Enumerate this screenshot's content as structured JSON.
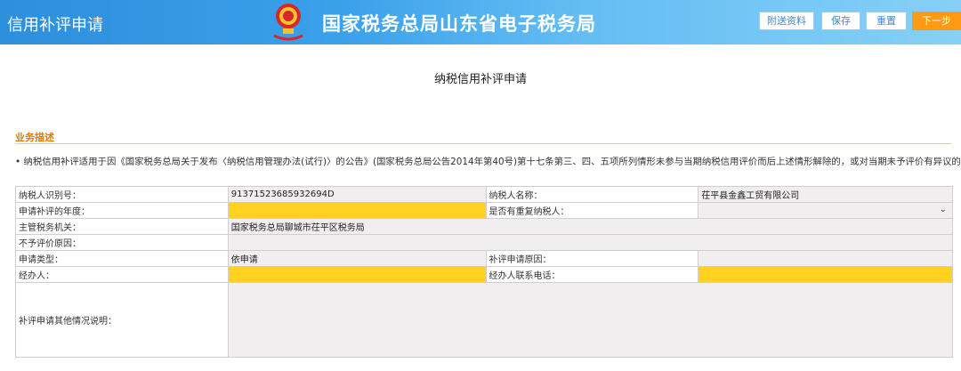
{
  "header": {
    "app_title": "信用补评申请",
    "bureau": "国家税务总局山东省电子税务局",
    "buttons": {
      "attach": "附送资料",
      "save": "保存",
      "reset": "重置",
      "next": "下一步"
    }
  },
  "page_title": "纳税信用补评申请",
  "section": {
    "title": "业务描述",
    "description": "• 纳税信用补评适用于因《国家税务总局关于发布〈纳税信用管理办法(试行)〉的公告》(国家税务总局公告2014年第40号)第十七条第三、四、五项所列情形未参与当期纳税信用评价而后上述情形解除的，或对当期未予评价有异议的纳税人。"
  },
  "form": {
    "taxpayer_id_label": "纳税人识别号：",
    "taxpayer_id": "91371523685932694D",
    "taxpayer_name_label": "纳税人名称：",
    "taxpayer_name": "茌平县金鑫工贸有限公司",
    "year_label": "申请补评的年度：",
    "year_value": "",
    "reregistered_label": "是否有重复纳税人：",
    "reregistered_value": "",
    "tax_office_label": "主管税务机关：",
    "tax_office": "国家税务总局聊城市茌平区税务局",
    "not_rated_label": "不予评价原因：",
    "not_rated_value": "",
    "app_type_label": "申请类型：",
    "app_type": "依申请",
    "reason_label": "补评申请原因：",
    "reason_value": "",
    "handler_label": "经办人：",
    "handler_value": "",
    "phone_label": "经办人联系电话：",
    "phone_value": "",
    "other_label": "补评申请其他情况说明：",
    "other_value": ""
  },
  "colors": {
    "header_start": "#2e8fdc",
    "header_end": "#86d0f7",
    "required": "#ffd21f",
    "accent": "#ff9a14",
    "section": "#e07b00"
  }
}
